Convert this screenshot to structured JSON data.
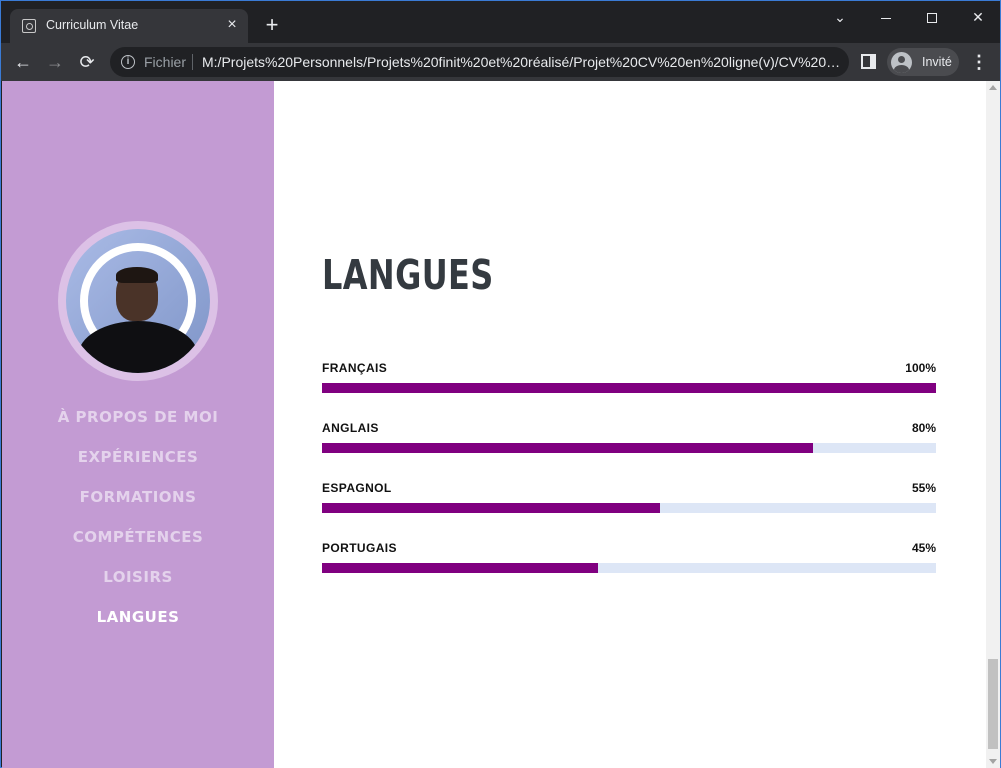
{
  "browser": {
    "tab_title": "Curriculum Vitae",
    "tab_close_icon": "×",
    "new_tab_icon": "+",
    "url_scheme": "Fichier",
    "url": "M:/Projets%20Personnels/Projets%20finit%20et%20réalisé/Projet%20CV%20en%20ligne(v)/CV%20e...",
    "profile_label": "Invité",
    "back_icon": "←",
    "forward_icon": "→",
    "reload_icon": "⟳",
    "menu_icon": "⋮",
    "dropdown_icon": "⌄",
    "close_icon": "✕"
  },
  "sidebar": {
    "nav": [
      {
        "label": "À PROPOS DE MOI",
        "active": false
      },
      {
        "label": "EXPÉRIENCES",
        "active": false
      },
      {
        "label": "FORMATIONS",
        "active": false
      },
      {
        "label": "COMPÉTENCES",
        "active": false
      },
      {
        "label": "LOISIRS",
        "active": false
      },
      {
        "label": "LANGUES",
        "active": true
      }
    ]
  },
  "section": {
    "title": "LANGUES",
    "languages": [
      {
        "name": "FRANÇAIS",
        "percent_label": "100%",
        "level": 1.0
      },
      {
        "name": "ANGLAIS",
        "percent_label": "80%",
        "level": 0.8
      },
      {
        "name": "ESPAGNOL",
        "percent_label": "55%",
        "level": 0.55
      },
      {
        "name": "PORTUGAIS",
        "percent_label": "45%",
        "level": 0.45
      }
    ]
  },
  "colors": {
    "sidebar_bg": "#c39bd3",
    "bar_fill": "#800080",
    "bar_track": "#dde6f6",
    "title": "#343a40"
  }
}
